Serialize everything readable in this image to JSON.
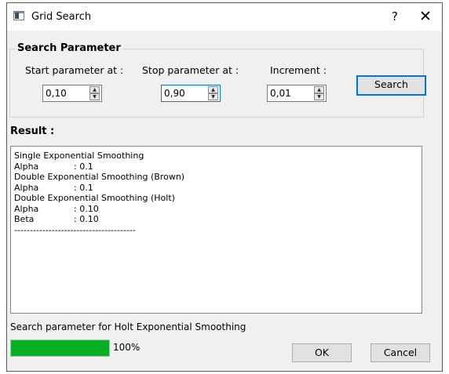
{
  "window": {
    "title": "Grid Search",
    "help_glyph": "?",
    "close_glyph": "✕"
  },
  "search_parameter": {
    "group_title": "Search Parameter",
    "start": {
      "label": "Start parameter at :",
      "value": "0,10"
    },
    "stop": {
      "label": "Stop parameter at :",
      "value": "0,90"
    },
    "increment": {
      "label": "Increment :",
      "value": "0,01"
    },
    "search_button": "Search"
  },
  "result": {
    "title": "Result :",
    "lines": [
      {
        "text": "Single Exponential Smoothing"
      },
      {
        "key": "Alpha",
        "value": ": 0.1"
      },
      {
        "text": "Double Exponential Smoothing (Brown)"
      },
      {
        "key": "Alpha",
        "value": ": 0.1"
      },
      {
        "text": "Double Exponential Smoothing (Holt)"
      },
      {
        "key": "Alpha",
        "value": ": 0.10"
      },
      {
        "key": "Beta",
        "value": ": 0.10"
      },
      {
        "text": "---------------------------------------"
      }
    ]
  },
  "status": {
    "text": "Search parameter for Holt Exponential Smoothing",
    "progress_percent": 100,
    "progress_label": "100%",
    "progress_color": "#06b025"
  },
  "buttons": {
    "ok": "OK",
    "cancel": "Cancel"
  },
  "icons": {
    "spin_up": "▲",
    "spin_down": "▼"
  }
}
